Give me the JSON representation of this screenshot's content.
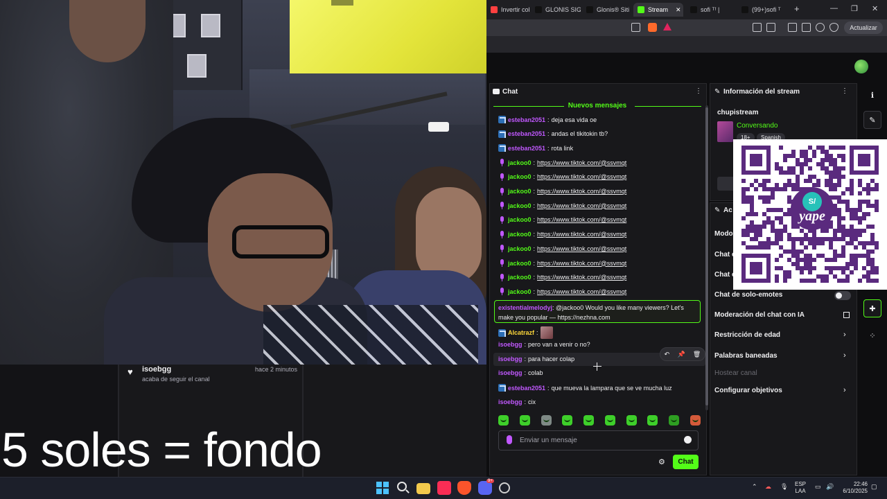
{
  "browser": {
    "tabs": [
      {
        "label": "Invertir colo",
        "color": "#ff4040"
      },
      {
        "label": "GLONIS SIG",
        "color": "#111111"
      },
      {
        "label": "Glonis® Siti",
        "color": "#111111"
      },
      {
        "label": "Stream",
        "color": "#53fc18",
        "active": true
      },
      {
        "label": "sofi ᵀᶠ |",
        "color": "#111111"
      },
      {
        "label": "(99+)sofi ᵀ",
        "color": "#111111"
      }
    ],
    "close_tab": "✕",
    "new_tab": "+",
    "min": "—",
    "max": "❐",
    "close": "✕",
    "update_label": "Actualizar"
  },
  "alert": {
    "user": "isoebgg",
    "time": "hace 2 minutos",
    "action": "acaba de seguir el canal"
  },
  "overlay_text": "5 soles = fondo",
  "chat": {
    "title": "Chat",
    "new_messages": "Nuevos mensajes",
    "messages": [
      {
        "user": "esteban2051",
        "text": "deja esa vida oe",
        "color": "#c158ff",
        "badge": "arrow",
        "link": false
      },
      {
        "user": "esteban2051",
        "text": "andas el tikitokin tb?",
        "color": "#c158ff",
        "badge": "arrow",
        "link": false
      },
      {
        "user": "esteban2051",
        "text": "rota link",
        "color": "#c158ff",
        "badge": "arrow",
        "link": false
      },
      {
        "user": "jackoo0",
        "text": "https://www.tiktok.com/@ssvmqt",
        "color": "#53fc18",
        "badge": "mic",
        "link": true
      },
      {
        "user": "jackoo0",
        "text": "https://www.tiktok.com/@ssvmqt",
        "color": "#53fc18",
        "badge": "mic",
        "link": true
      },
      {
        "user": "jackoo0",
        "text": "https://www.tiktok.com/@ssvmqt",
        "color": "#53fc18",
        "badge": "mic",
        "link": true
      },
      {
        "user": "jackoo0",
        "text": "https://www.tiktok.com/@ssvmqt",
        "color": "#53fc18",
        "badge": "mic",
        "link": true
      },
      {
        "user": "jackoo0",
        "text": "https://www.tiktok.com/@ssvmqt",
        "color": "#53fc18",
        "badge": "mic",
        "link": true
      },
      {
        "user": "jackoo0",
        "text": "https://www.tiktok.com/@ssvmqt",
        "color": "#53fc18",
        "badge": "mic",
        "link": true
      },
      {
        "user": "jackoo0",
        "text": "https://www.tiktok.com/@ssvmqt",
        "color": "#53fc18",
        "badge": "mic",
        "link": true
      },
      {
        "user": "jackoo0",
        "text": "https://www.tiktok.com/@ssvmqt",
        "color": "#53fc18",
        "badge": "mic",
        "link": true
      },
      {
        "user": "jackoo0",
        "text": "https://www.tiktok.com/@ssvmqt",
        "color": "#53fc18",
        "badge": "mic",
        "link": true
      },
      {
        "user": "jackoo0",
        "text": "https://www.tiktok.com/@ssvmqt",
        "color": "#53fc18",
        "badge": "mic",
        "link": true
      }
    ],
    "highlight": {
      "user": "existentialmelodyj",
      "text": "@jackoo0 Would you like many viewers? Let's make you popular — https://nezhna.com"
    },
    "messages_after": [
      {
        "user": "Alcatrazf",
        "text": "",
        "color": "#ffd83a",
        "badge": "arrow",
        "emote": true
      },
      {
        "user": "isoebgg",
        "text": "pero van a venir o no?",
        "color": "#c158ff",
        "badge": ""
      },
      {
        "user": "isoebgg",
        "text": "para hacer colap",
        "color": "#c158ff",
        "badge": ""
      },
      {
        "user": "isoebgg",
        "text": "colab",
        "color": "#c158ff",
        "badge": ""
      },
      {
        "user": "esteban2051",
        "text": "que mueva la lampara que se ve mucha luz",
        "color": "#c158ff",
        "badge": "arrow"
      },
      {
        "user": "isoebgg",
        "text": "cix",
        "color": "#c158ff",
        "badge": ""
      }
    ],
    "hover_tools": [
      "↶",
      "📌",
      "🗑"
    ],
    "input_placeholder": "Enviar un mensaje",
    "send_label": "Chat",
    "settings_icon": "⚙"
  },
  "stream_info": {
    "title": "Información del stream",
    "stream_name": "chupistream",
    "category": "Conversando",
    "tags": [
      "18+",
      "Spanish"
    ]
  },
  "actions": {
    "title": "Ac",
    "rows": [
      {
        "label": "Modo",
        "chevron": false,
        "disabled": false
      },
      {
        "label": "Chat c",
        "chevron": false,
        "disabled": false
      },
      {
        "label": "Chat c",
        "chevron": false,
        "disabled": false
      },
      {
        "label": "Chat de solo-emotes",
        "chevron": false,
        "disabled": false
      },
      {
        "label": "Moderación del chat con IA",
        "chevron": false,
        "disabled": false
      },
      {
        "label": "Restricción de edad",
        "chevron": true,
        "disabled": false
      },
      {
        "label": "Palabras baneadas",
        "chevron": true,
        "disabled": false
      },
      {
        "label": "Hostear canal",
        "chevron": false,
        "disabled": true
      },
      {
        "label": "Configurar objetivos",
        "chevron": true,
        "disabled": false
      }
    ]
  },
  "qr": {
    "logo_badge": "S/",
    "logo_text": "yape"
  },
  "taskbar": {
    "lang_line1": "ESP",
    "lang_line2": "LAA",
    "time": "22:46",
    "date": "6/10/2025",
    "discord_badge": "9+"
  }
}
